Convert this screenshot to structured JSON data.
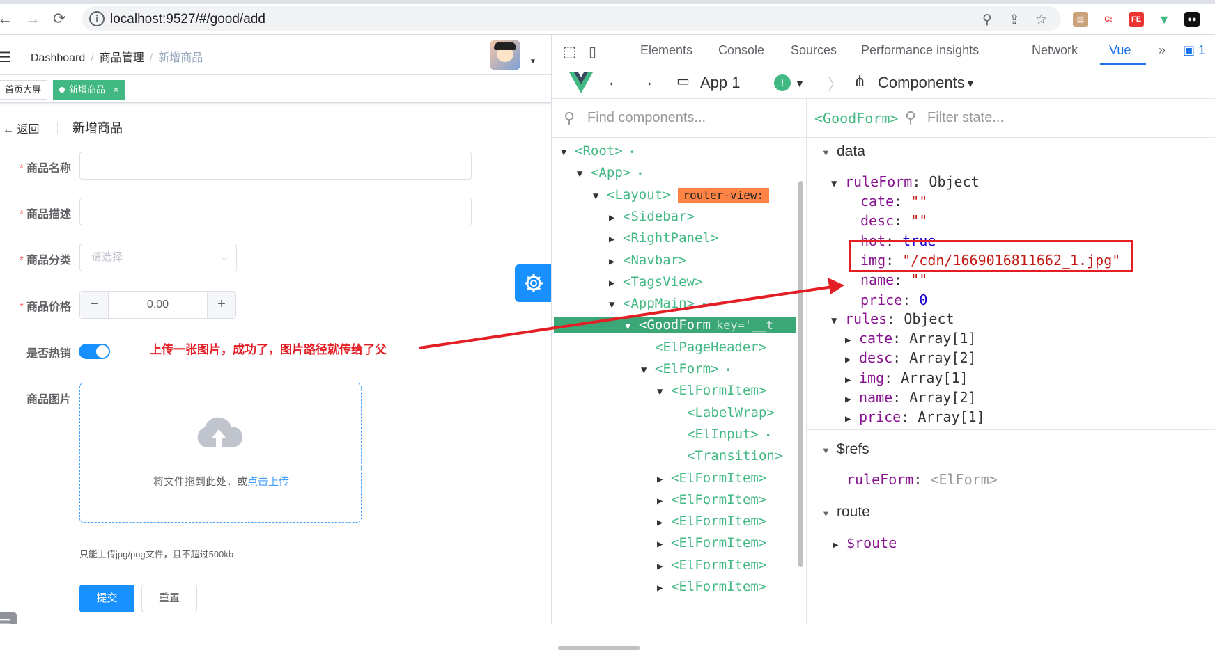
{
  "browser": {
    "url": "localhost:9527/#/good/add"
  },
  "app": {
    "breadcrumb": [
      "Dashboard",
      "商品管理",
      "新增商品"
    ],
    "tags": [
      {
        "label": "首页大屏"
      },
      {
        "label": "新增商品",
        "close": "×"
      }
    ],
    "page_header": {
      "back": "返回",
      "title": "新增商品"
    },
    "form": {
      "name_label": "商品名称",
      "desc_label": "商品描述",
      "cate_label": "商品分类",
      "cate_placeholder": "请选择",
      "price_label": "商品价格",
      "price_value": "0.00",
      "minus": "−",
      "plus": "+",
      "hot_label": "是否热销",
      "hot_on": true,
      "img_label": "商品图片",
      "upload_text": "将文件拖到此处，或",
      "upload_link": "点击上传",
      "upload_tip": "只能上传jpg/png文件，且不超过500kb",
      "submit": "提交",
      "reset": "重置"
    },
    "annotation": "上传一张图片，成功了，图片路径就传给了父"
  },
  "devtools": {
    "tabs": [
      "Elements",
      "Console",
      "Sources",
      "Performance insights",
      "Network",
      "Vue"
    ],
    "active_tab": "Vue",
    "issues_count": "1",
    "vue_bar": {
      "app": "App 1",
      "components": "Components"
    },
    "find_placeholder": "Find components...",
    "filter_placeholder": "Filter state...",
    "selected_component": "<GoodForm>",
    "tree": [
      {
        "label": "<Root>",
        "expanded": true,
        "dot": true
      },
      {
        "label": "<App>",
        "expanded": true,
        "dot": true
      },
      {
        "label": "<Layout>",
        "expanded": true,
        "badge": "router-view:"
      },
      {
        "label": "<Sidebar>"
      },
      {
        "label": "<RightPanel>"
      },
      {
        "label": "<Navbar>"
      },
      {
        "label": "<TagsView>"
      },
      {
        "label": "<AppMain>",
        "expanded": true,
        "dot": true
      },
      {
        "label": "<GoodForm",
        "key": "key='__t",
        "selected": true
      },
      {
        "label": "<ElPageHeader>"
      },
      {
        "label": "<ElForm>",
        "expanded": true,
        "dot": true
      },
      {
        "label": "<ElFormItem>",
        "expanded": true
      },
      {
        "label": "<LabelWrap>"
      },
      {
        "label": "<ElInput>",
        "dot": true
      },
      {
        "label": "<Transition>"
      },
      {
        "label": "<ElFormItem>"
      },
      {
        "label": "<ElFormItem>"
      },
      {
        "label": "<ElFormItem>"
      },
      {
        "label": "<ElFormItem>"
      },
      {
        "label": "<ElFormItem>"
      },
      {
        "label": "<ElFormItem>"
      }
    ],
    "state": {
      "data_section": "data",
      "ruleForm": "ruleForm",
      "ruleForm_type": "Object",
      "fields": [
        {
          "k": "cate",
          "v": "\"\""
        },
        {
          "k": "desc",
          "v": "\"\""
        },
        {
          "k": "hot",
          "v": "true"
        },
        {
          "k": "img",
          "v": "\"/cdn/1669016811662_1.jpg\""
        },
        {
          "k": "name",
          "v": "\"\""
        },
        {
          "k": "price",
          "v": "0"
        }
      ],
      "rules": "rules",
      "rules_type": "Object",
      "rule_items": [
        {
          "k": "cate",
          "v": "Array[1]"
        },
        {
          "k": "desc",
          "v": "Array[2]"
        },
        {
          "k": "img",
          "v": "Array[1]"
        },
        {
          "k": "name",
          "v": "Array[2]"
        },
        {
          "k": "price",
          "v": "Array[1]"
        }
      ],
      "refs_section": "$refs",
      "refs_key": "ruleForm",
      "refs_val": "<ElForm>",
      "route_section": "route",
      "route_key": "$route"
    }
  },
  "colors": {
    "accent": "#1890ff",
    "vue_green": "#42b983",
    "annotation_red": "#e31e24"
  }
}
